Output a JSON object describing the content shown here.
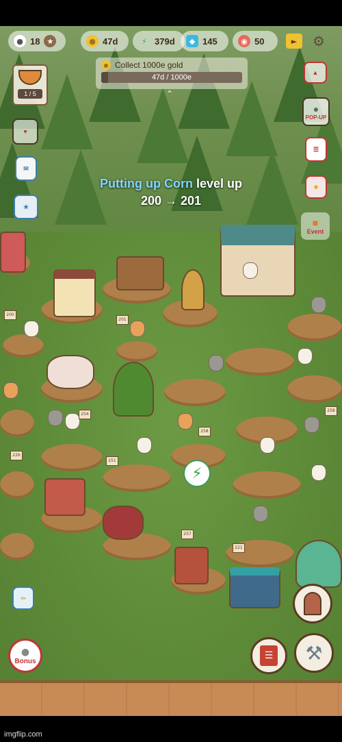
{
  "hud": {
    "cats": "18",
    "gold": "47d",
    "energy": "379d",
    "gems": "145",
    "tickets": "50"
  },
  "recipe": {
    "progress": "1 / 5"
  },
  "quest": {
    "title": "Collect 1000e gold",
    "progress_text": "47d / 1000e",
    "progress_fraction": 0.05
  },
  "toast": {
    "item": "Putting up Corn",
    "suffix": "level up",
    "from": "200",
    "arrow": "→",
    "to": "201"
  },
  "right_menu": {
    "popup_label": "POP-UP",
    "event_label": "Event"
  },
  "bonus_label": "Bonus",
  "watermark": "imgflip.com",
  "scene_signs": [
    "200",
    "201",
    "258",
    "258",
    "254",
    "251",
    "257",
    "221",
    "226"
  ],
  "colors": {
    "quest_highlight": "#7fd6ff",
    "energy": "#36a84f",
    "grass": "#5e8a3c"
  }
}
